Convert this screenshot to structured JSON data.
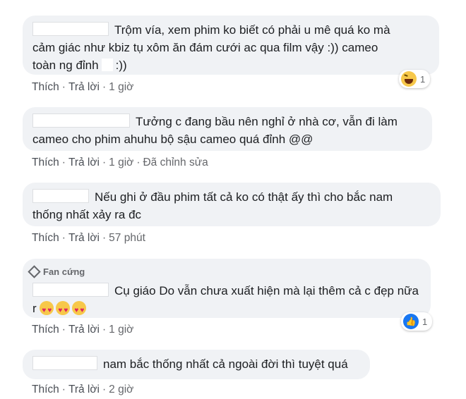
{
  "comments": [
    {
      "line1": "Trộm vía, xem phim ko biết có phải u mê quá ko mà",
      "line2": "cảm giác như kbiz tụ xôm ăn đám cưới ac qua film vậy :)) cameo",
      "line3a": "toàn ng đỉnh",
      "line3b": ":))",
      "like": "Thích",
      "reply": "Trả lời",
      "time": "1 giờ",
      "reaction_count": "1",
      "reaction_icon": "haha-emoji-icon"
    },
    {
      "line1": "Tưởng c đang bầu nên nghỉ ở nhà cơ, vẫn đi làm",
      "line2": "cameo cho phim ahuhu bộ sậu cameo quá đỉnh @@",
      "like": "Thích",
      "reply": "Trả lời",
      "time": "1 giờ",
      "edited": "Đã chỉnh sửa"
    },
    {
      "line1": "Nếu ghi ở đầu phim tất cả ko có thật ấy thì cho bắc nam",
      "line2": "thống nhất xảy ra đc",
      "like": "Thích",
      "reply": "Trả lời",
      "time": "57 phút"
    },
    {
      "badge": "Fan cứng",
      "line1": "Cụ giáo Do vẫn chưa xuất hiện mà lại thêm cả c đẹp nữa",
      "line2": "r",
      "like": "Thích",
      "reply": "Trả lời",
      "time": "1 giờ",
      "reaction_count": "1",
      "reaction_icon": "like-icon"
    },
    {
      "line1": "nam bắc thống nhất cả ngoài đời thì tuyệt quá",
      "like": "Thích",
      "reply": "Trả lời",
      "time": "2 giờ"
    }
  ],
  "colors": {
    "bubble": "#f0f2f5",
    "meta": "#65676b",
    "like_blue": "#1877f2",
    "haha_yellow": "#f7c84a"
  }
}
